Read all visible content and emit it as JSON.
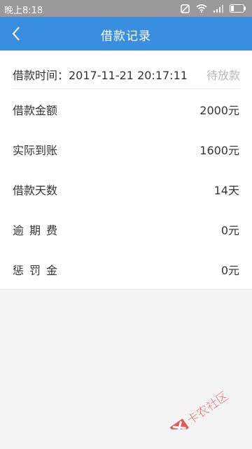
{
  "status_bar": {
    "time": "晚上8:18",
    "icons": [
      "dnd-icon",
      "wifi-icon",
      "signal-icon",
      "battery-icon"
    ]
  },
  "app_bar": {
    "title": "借款记录",
    "back_icon": "back-arrow-icon",
    "color": "#3a8ee0"
  },
  "record": {
    "time_label": "借款时间：2017-11-21 20:17:11",
    "status": "待放款",
    "rows": [
      {
        "label": "借款金额",
        "value": "2000元"
      },
      {
        "label": "实际到账",
        "value": "1600元"
      },
      {
        "label": "借款天数",
        "value": "14天"
      },
      {
        "label": "逾期费",
        "value": "0元"
      },
      {
        "label": "惩罚金",
        "value": "0元"
      }
    ]
  },
  "watermark": {
    "text": "卡农社区"
  }
}
